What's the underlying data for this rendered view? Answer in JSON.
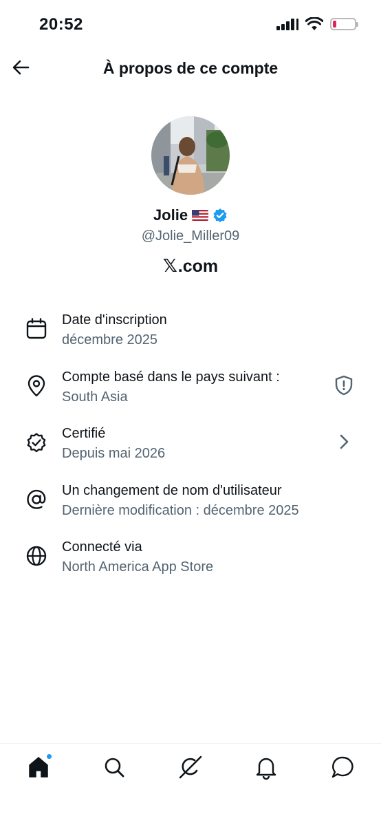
{
  "status_bar": {
    "time": "20:52",
    "battery_level": 0.15,
    "battery_color": "#e0245e"
  },
  "header": {
    "title": "À propos de ce compte",
    "back_icon": "arrow-left-icon"
  },
  "profile": {
    "name": "Jolie",
    "flag": "us-flag-icon",
    "verified_badge": "verified-check-icon",
    "verified_color": "#1d9bf0",
    "handle": "@Jolie_Miller09",
    "domain_logo": "𝕏",
    "domain_text": ".com"
  },
  "info_items": [
    {
      "icon": "calendar-icon",
      "label": "Date d'inscription",
      "value": "décembre 2025"
    },
    {
      "icon": "location-pin-icon",
      "label": "Compte basé dans le pays suivant :",
      "value": "South Asia",
      "trailing": "shield-alert-icon"
    },
    {
      "icon": "verified-seal-icon",
      "label": "Certifié",
      "value": "Depuis mai 2026",
      "trailing": "chevron-right-icon"
    },
    {
      "icon": "at-sign-icon",
      "label": "Un changement de nom d'utilisateur",
      "value": "Dernière modification : décembre 2025"
    },
    {
      "icon": "globe-icon",
      "label": "Connecté via",
      "value": "North America App Store"
    }
  ],
  "bottom_nav": {
    "items": [
      "home-icon",
      "search-icon",
      "grok-icon",
      "notifications-bell-icon",
      "messages-icon"
    ],
    "active": "home-icon",
    "notification_dot_color": "#1d9bf0"
  }
}
